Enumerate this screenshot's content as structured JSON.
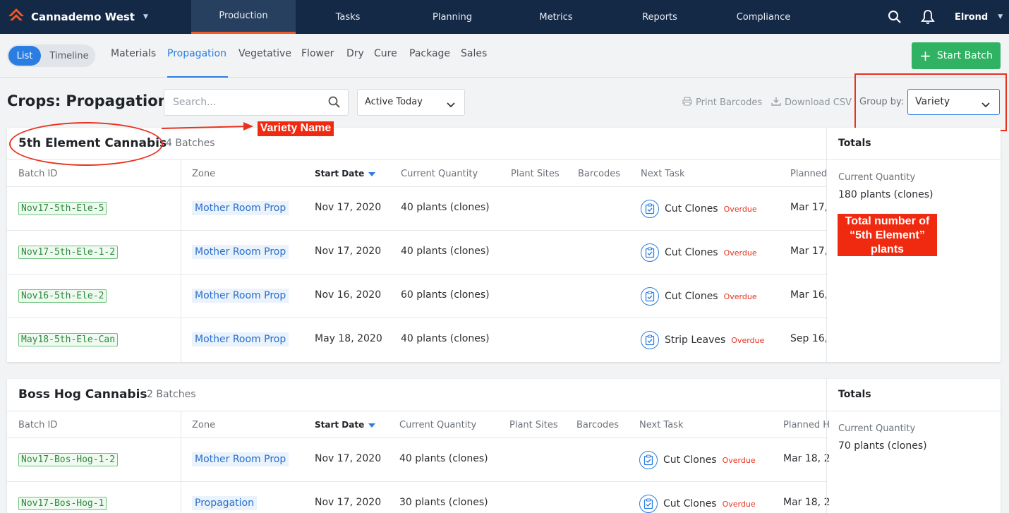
{
  "app": {
    "facility": "Cannademo West",
    "user": "Elrond",
    "brand_color": "#f05a28",
    "accent": "#2a7de1",
    "nav_tabs": [
      {
        "label": "Production",
        "active": true
      },
      {
        "label": "Tasks"
      },
      {
        "label": "Planning"
      },
      {
        "label": "Metrics"
      },
      {
        "label": "Reports"
      },
      {
        "label": "Compliance"
      }
    ]
  },
  "subnav": {
    "view_toggle": [
      "List",
      "Timeline"
    ],
    "stages": [
      "Materials",
      "Propagation",
      "Vegetative",
      "Flower",
      "Dry",
      "Cure",
      "Package",
      "Sales"
    ],
    "active_stage": "Propagation",
    "start_batch": "Start Batch"
  },
  "toolbar": {
    "title": "Crops: Propagation",
    "search_placeholder": "Search...",
    "filter": "Active Today",
    "print_barcodes": "Print Barcodes",
    "download_csv": "Download CSV",
    "group_by_label": "Group by:",
    "group_by_value": "Variety"
  },
  "columns": [
    "Batch ID",
    "Zone",
    "Start Date",
    "Current Quantity",
    "Plant Sites",
    "Barcodes",
    "Next Task",
    "Planned"
  ],
  "columns_group2": [
    "Batch ID",
    "Zone",
    "Start Date",
    "Current Quantity",
    "Plant Sites",
    "Barcodes",
    "Next Task",
    "Planned H"
  ],
  "groups": [
    {
      "variety": "5th Element Cannabis",
      "count": "4 Batches",
      "totals_title": "Totals",
      "totals_label": "Current Quantity",
      "totals_value": "180 plants (clones)",
      "rows": [
        {
          "id": "Nov17-5th-Ele-5",
          "zone": "Mother Room Prop",
          "start": "Nov 17, 2020",
          "qty": "40 plants (clones)",
          "task": "Cut Clones",
          "status": "Overdue",
          "planned": "Mar 17,"
        },
        {
          "id": "Nov17-5th-Ele-1-2",
          "zone": "Mother Room Prop",
          "start": "Nov 17, 2020",
          "qty": "40 plants (clones)",
          "task": "Cut Clones",
          "status": "Overdue",
          "planned": "Mar 17,"
        },
        {
          "id": "Nov16-5th-Ele-2",
          "zone": "Mother Room Prop",
          "start": "Nov 16, 2020",
          "qty": "60 plants (clones)",
          "task": "Cut Clones",
          "status": "Overdue",
          "planned": "Mar 16,"
        },
        {
          "id": "May18-5th-Ele-Can",
          "zone": "Mother Room Prop",
          "start": "May 18, 2020",
          "qty": "40 plants (clones)",
          "task": "Strip Leaves",
          "status": "Overdue",
          "planned": "Sep 16,"
        }
      ]
    },
    {
      "variety": "Boss Hog Cannabis",
      "count": "2 Batches",
      "totals_title": "Totals",
      "totals_label": "Current Quantity",
      "totals_value": "70 plants (clones)",
      "rows": [
        {
          "id": "Nov17-Bos-Hog-1-2",
          "zone": "Mother Room Prop",
          "start": "Nov 17, 2020",
          "qty": "40 plants (clones)",
          "task": "Cut Clones",
          "status": "Overdue",
          "planned": "Mar 18, 2"
        },
        {
          "id": "Nov17-Bos-Hog-1",
          "zone": "Propagation",
          "start": "Nov 17, 2020",
          "qty": "30 plants (clones)",
          "task": "Cut Clones",
          "status": "Overdue",
          "planned": "Mar 18, 2"
        }
      ]
    }
  ],
  "annotations": {
    "variety_name": "Variety Name",
    "total_line1": "Total number of",
    "total_line2": "“5th Element”",
    "total_line3": "plants",
    "color": "#e8321f"
  }
}
